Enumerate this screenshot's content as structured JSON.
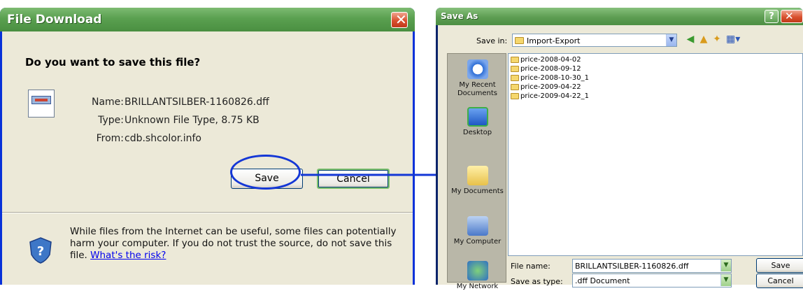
{
  "file_download": {
    "title": "File Download",
    "question": "Do you want to save this file?",
    "name_label": "Name:",
    "name_value": "BRILLANTSILBER-1160826.dff",
    "type_label": "Type:",
    "type_value": "Unknown File Type, 8.75 KB",
    "from_label": "From:",
    "from_value": "cdb.shcolor.info",
    "save_label": "Save",
    "cancel_label": "Cancel",
    "warning_text": "While files from the Internet can be useful, some files can potentially harm your computer. If you do not trust the source, do not save this file.",
    "warning_link": "What's the risk?"
  },
  "save_as": {
    "title": "Save As",
    "help_label": "?",
    "save_in_label": "Save in:",
    "save_in_value": "Import-Export",
    "places": [
      "My Recent Documents",
      "Desktop",
      "My Documents",
      "My Computer",
      "My Network"
    ],
    "files": [
      "price-2008-04-02",
      "price-2008-09-12",
      "price-2008-10-30_1",
      "price-2009-04-22",
      "price-2009-04-22_1"
    ],
    "file_name_label": "File name:",
    "file_name_value": "BRILLANTSILBER-1160826.dff",
    "save_type_label": "Save as type:",
    "save_type_value": ".dff Document",
    "save_label": "Save",
    "cancel_label": "Cancel"
  },
  "colors": {
    "xp_title_green": "#5aa050",
    "dialog_face": "#ece9d8",
    "highlight_blue": "#1437d6"
  }
}
